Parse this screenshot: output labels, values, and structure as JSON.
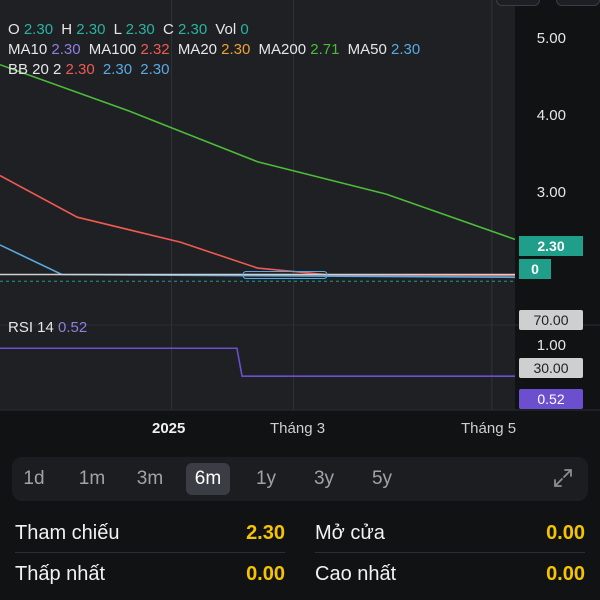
{
  "legend": {
    "ohlc": [
      {
        "label": "O",
        "value": "2.30"
      },
      {
        "label": "H",
        "value": "2.30"
      },
      {
        "label": "L",
        "value": "2.30"
      },
      {
        "label": "C",
        "value": "2.30"
      },
      {
        "label": "Vol",
        "value": "0"
      }
    ],
    "ma": [
      {
        "label": "MA10",
        "value": "2.30",
        "color": "#8e7fe0"
      },
      {
        "label": "MA100",
        "value": "2.32",
        "color": "#f05a50"
      },
      {
        "label": "MA20",
        "value": "2.30",
        "color": "#f0a030"
      },
      {
        "label": "MA200",
        "value": "2.71",
        "color": "#4cbb3a"
      },
      {
        "label": "MA50",
        "value": "2.30",
        "color": "#5aa9e0"
      }
    ],
    "bb": {
      "label": "BB 20 2",
      "values": [
        "2.30",
        "2.30",
        "2.30"
      ],
      "colors": [
        "#f05a50",
        "#5aa9e0",
        "#5aa9e0"
      ]
    },
    "ohlc_color": "#2ab3a0",
    "vol_color": "#2ab3a0"
  },
  "chart_data": {
    "type": "line",
    "price_axis": {
      "ticks": [
        "5.00",
        "4.00",
        "3.00"
      ],
      "range": [
        2.0,
        5.3
      ]
    },
    "x_axis": {
      "labels": [
        "2025",
        "Tháng 3",
        "Tháng 5"
      ]
    },
    "series": [
      {
        "name": "MA200",
        "color": "#4cbb3a",
        "x": [
          0,
          0.25,
          0.5,
          0.75,
          1.0
        ],
        "y": [
          4.6,
          4.1,
          3.55,
          3.2,
          2.71
        ]
      },
      {
        "name": "MA100",
        "color": "#f05a50",
        "x": [
          0,
          0.15,
          0.35,
          0.5,
          0.65,
          1.0
        ],
        "y": [
          3.4,
          2.95,
          2.68,
          2.4,
          2.32,
          2.32
        ]
      },
      {
        "name": "MA50",
        "color": "#5aa9e0",
        "x": [
          0,
          0.12,
          1.0
        ],
        "y": [
          2.65,
          2.33,
          2.3
        ]
      },
      {
        "name": "Close",
        "color": "#d0d0d0",
        "x": [
          0,
          1.0
        ],
        "y": [
          2.33,
          2.33
        ]
      }
    ],
    "last_price": "2.30",
    "volume_tag": "0",
    "rsi": {
      "label": "RSI 14",
      "value": "0.52",
      "value_color": "#8e7fe0",
      "axis_ticks": [
        "70.00",
        "1.00",
        "30.00"
      ],
      "series": {
        "x": [
          0,
          0.46,
          0.47,
          1.0
        ],
        "y": [
          0.95,
          0.95,
          0.52,
          0.52
        ]
      }
    }
  },
  "ranges": {
    "items": [
      "1d",
      "1m",
      "3m",
      "6m",
      "1y",
      "3y",
      "5y"
    ],
    "active": "6m"
  },
  "stats": {
    "reference_label": "Tham chiếu",
    "reference_value": "2.30",
    "open_label": "Mở cửa",
    "open_value": "0.00",
    "low_label": "Thấp nhất",
    "low_value": "0.00",
    "high_label": "Cao nhất",
    "high_value": "0.00"
  },
  "colors": {
    "accent_teal": "#1f9e89",
    "rsi_purple": "#6c4fcf",
    "value_yellow": "#f5c400"
  }
}
